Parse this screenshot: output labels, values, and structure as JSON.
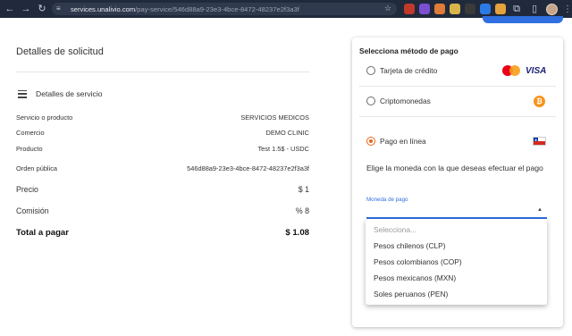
{
  "browser": {
    "url_host": "services.unalivio.com",
    "url_path": "/pay-service/546d88a9-23e3-4bce-8472-48237e2f3a3f"
  },
  "left": {
    "title": "Detalles de solicitud",
    "service_header": "Detalles de servicio",
    "rows": [
      {
        "label": "Servicio o producto",
        "value": "SERVICIOS MEDICOS"
      },
      {
        "label": "Comercio",
        "value": "DEMO CLINIC"
      },
      {
        "label": "Producto",
        "value": "Test 1.5$ - USDC"
      },
      {
        "label": "Orden pública",
        "value": "546d88a9-23e3-4bce-8472-48237e2f3a3f"
      }
    ],
    "price": {
      "label": "Precio",
      "value": "$ 1"
    },
    "commission": {
      "label": "Comisión",
      "value": "% 8"
    },
    "total": {
      "label": "Total a pagar",
      "value": "$ 1.08"
    }
  },
  "payment": {
    "title": "Selecciona método de pago",
    "options": [
      {
        "label": "Tarjeta de crédito",
        "selected": false
      },
      {
        "label": "Criptomonedas",
        "selected": false
      },
      {
        "label": "Pago en línea",
        "selected": true
      }
    ],
    "visa_text": "VISA",
    "btc_glyph": "₿",
    "currency_question": "Elige la moneda con la que deseas efectuar el pago",
    "field_label": "Moneda de pago",
    "dropdown": {
      "placeholder": "Selecciona...",
      "options": [
        "Pesos chilenos (CLP)",
        "Pesos colombianos (COP)",
        "Pesos mexicanos (MXN)",
        "Soles peruanos (PEN)"
      ]
    }
  },
  "colors": {
    "accent": "#e8661f",
    "link_blue": "#2f6fe0"
  }
}
